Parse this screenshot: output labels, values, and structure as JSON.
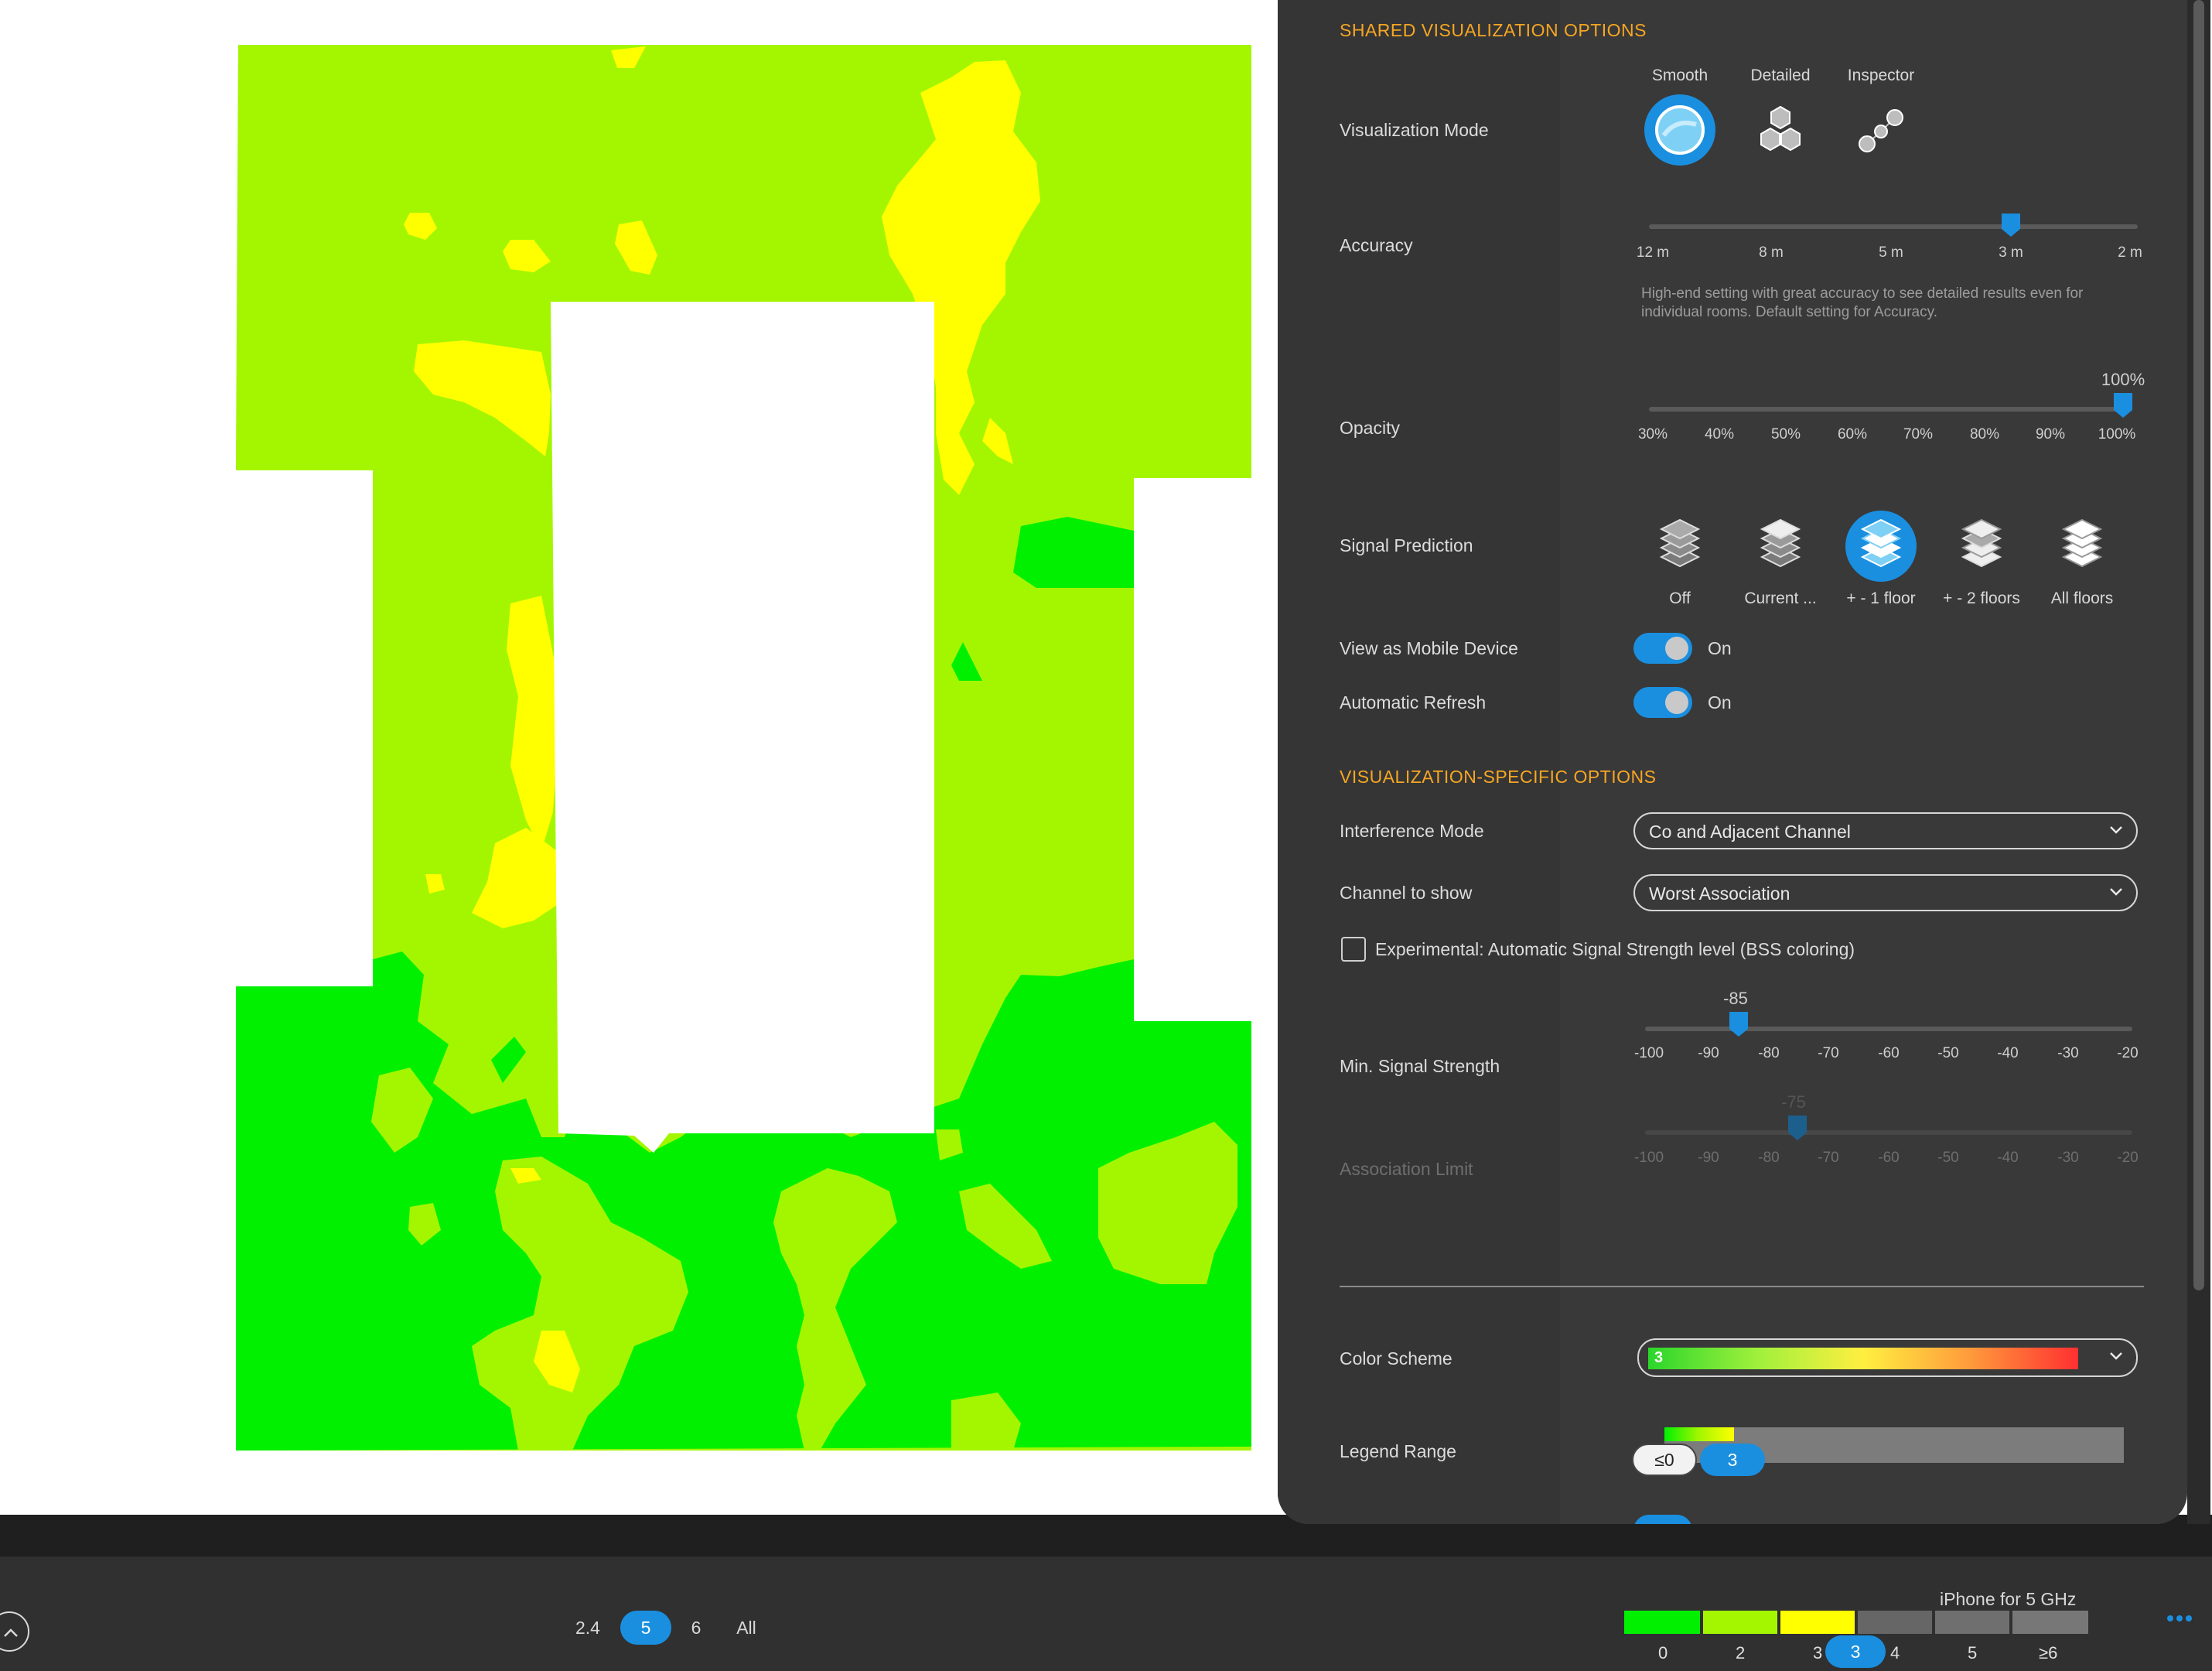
{
  "colors": {
    "panel_bg": "#393939",
    "section_header": "#f6a623",
    "accent": "#1a8fe0",
    "heat_green": "#00f000",
    "heat_lime": "#a4f600",
    "heat_yellow": "#ffff00"
  },
  "shared": {
    "header": "SHARED VISUALIZATION OPTIONS",
    "visualization_mode": {
      "label": "Visualization Mode",
      "options": [
        "Smooth",
        "Detailed",
        "Inspector"
      ],
      "selected": "Smooth"
    },
    "accuracy": {
      "label": "Accuracy",
      "ticks": [
        "12 m",
        "8 m",
        "5 m",
        "3 m",
        "2 m"
      ],
      "value": "3 m",
      "note": "High-end setting with great accuracy to see detailed results even for individual rooms. Default setting for Accuracy."
    },
    "opacity": {
      "label": "Opacity",
      "ticks": [
        "30%",
        "40%",
        "50%",
        "60%",
        "70%",
        "80%",
        "90%",
        "100%"
      ],
      "value": "100%"
    },
    "signal_prediction": {
      "label": "Signal Prediction",
      "options": [
        "Off",
        "Current ...",
        "+ - 1 floor",
        "+ - 2 floors",
        "All floors"
      ],
      "selected": "+ - 1 floor"
    },
    "view_as_mobile": {
      "label": "View as Mobile Device",
      "state": "On"
    },
    "auto_refresh": {
      "label": "Automatic Refresh",
      "state": "On"
    }
  },
  "specific": {
    "header": "VISUALIZATION-SPECIFIC OPTIONS",
    "interference_mode": {
      "label": "Interference Mode",
      "value": "Co and Adjacent Channel"
    },
    "channel_to_show": {
      "label": "Channel to show",
      "value": "Worst Association"
    },
    "experimental": {
      "label": "Experimental: Automatic Signal Strength level (BSS coloring)",
      "checked": false
    },
    "min_signal": {
      "label": "Min. Signal Strength",
      "ticks": [
        "-100",
        "-90",
        "-80",
        "-70",
        "-60",
        "-50",
        "-40",
        "-30",
        "-20"
      ],
      "value": "-85"
    },
    "association_limit": {
      "label": "Association Limit",
      "ticks": [
        "-100",
        "-90",
        "-80",
        "-70",
        "-60",
        "-50",
        "-40",
        "-30",
        "-20"
      ],
      "value": "-75",
      "disabled": true
    }
  },
  "color_scheme": {
    "label": "Color Scheme",
    "value": "3"
  },
  "legend_range": {
    "label": "Legend Range",
    "min": "≤0",
    "max": "3"
  },
  "bottom": {
    "bands": [
      "2.4",
      "5",
      "6",
      "All"
    ],
    "selected_band": "5",
    "device": "iPhone for 5 GHz",
    "legend_ticks": [
      "0",
      "2",
      "3",
      "4",
      "5",
      "≥6"
    ],
    "legend_marker": "3",
    "legend_colors": [
      "#00f000",
      "#a4f600",
      "#ffff00",
      "#666666",
      "#6f6f6f",
      "#777777"
    ],
    "more_icon": "more-dots-icon",
    "expand_icon": "chevron-up-icon"
  }
}
